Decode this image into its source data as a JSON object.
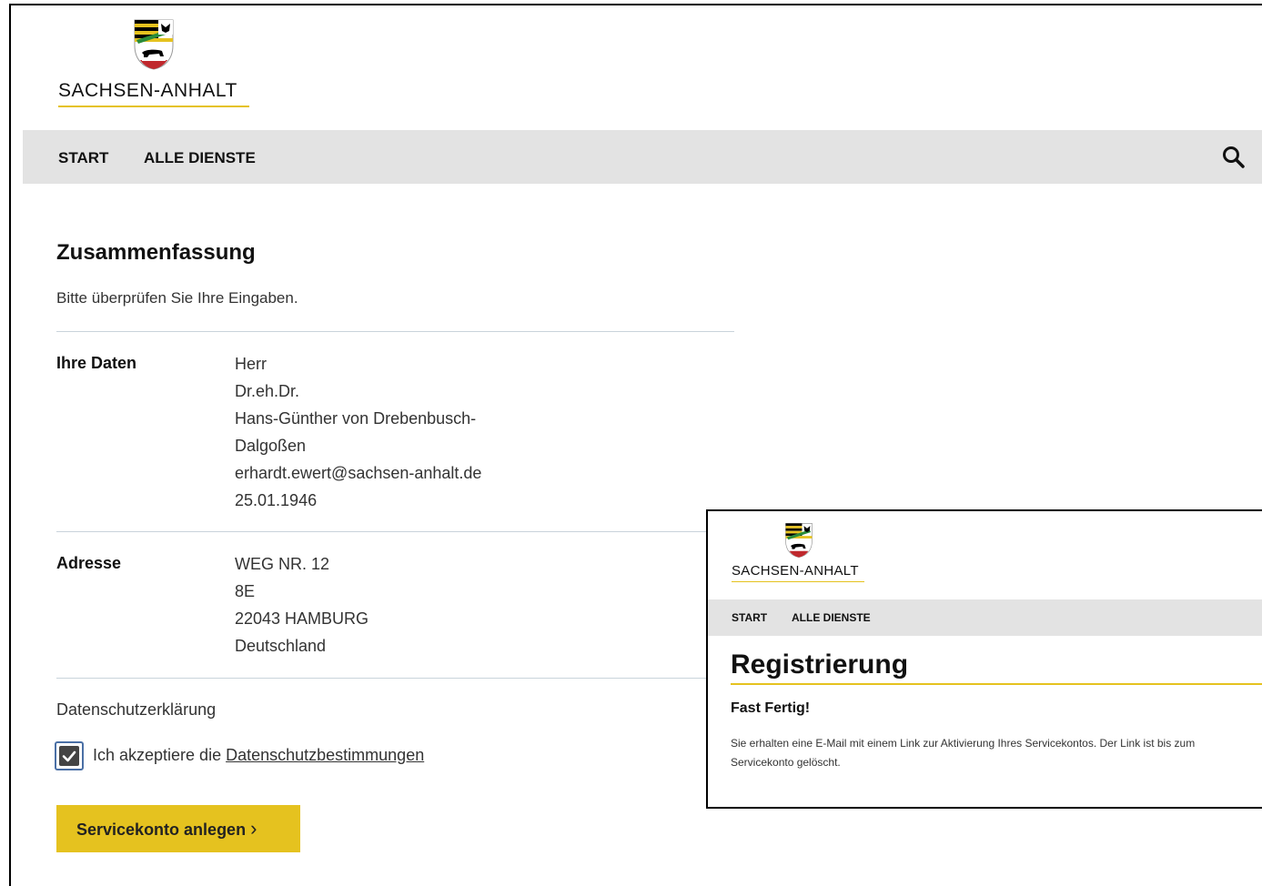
{
  "header": {
    "brand": "SACHSEN-ANHALT",
    "crest_icon": "coat-of-arms-icon"
  },
  "nav": {
    "items": [
      {
        "label": "START"
      },
      {
        "label": "ALLE DIENSTE"
      }
    ],
    "search_icon": "search-icon"
  },
  "summary": {
    "title": "Zusammenfassung",
    "intro": "Bitte überprüfen Sie Ihre Eingaben.",
    "personal": {
      "label": "Ihre Daten",
      "lines": [
        "Herr",
        "Dr.eh.Dr.",
        "Hans-Günther von Drebenbusch-",
        "Dalgoßen",
        "erhardt.ewert@sachsen-anhalt.de",
        "25.01.1946"
      ]
    },
    "address": {
      "label": "Adresse",
      "lines": [
        "WEG NR. 12",
        "8E",
        "22043 HAMBURG",
        "Deutschland"
      ]
    },
    "privacy": {
      "title": "Datenschutzerklärung",
      "checked": true,
      "checkbox_text": "Ich akzeptiere die ",
      "link_text": "Datenschutzbestimmungen"
    },
    "submit_label": "Servicekonto anlegen",
    "submit_arrow": "›"
  },
  "overlay": {
    "brand": "SACHSEN-ANHALT",
    "nav": [
      {
        "label": "START"
      },
      {
        "label": "ALLE DIENSTE"
      }
    ],
    "title": "Registrierung",
    "subtitle": "Fast Fertig!",
    "text_line1": "Sie erhalten eine E-Mail mit einem Link zur Aktivierung Ihres Servicekontos. Der Link ist bis zum",
    "text_line2": "Servicekonto gelöscht."
  },
  "colors": {
    "accent": "#e5c21f",
    "nav_bg": "#e3e3e3",
    "divider": "#c9d3db"
  }
}
